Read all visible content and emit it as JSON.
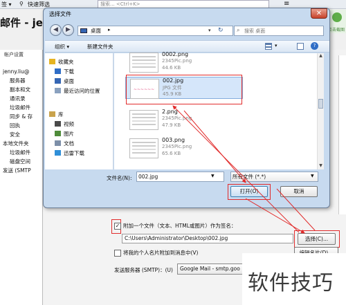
{
  "background": {
    "topbar_left": "签 ▾",
    "quick_filter": "快速筛选",
    "search_placeholder": "搜索... <Ctrl+K>",
    "menu_icon": "≡",
    "heading": "邮件 - jen",
    "right_tool_label": "点击截图",
    "account_panel_title": "帐户设置",
    "account_tree": [
      {
        "label": "jenny.liu@",
        "level": 0
      },
      {
        "label": "服务器",
        "level": 1
      },
      {
        "label": "副本和文",
        "level": 1
      },
      {
        "label": "通讯录",
        "level": 1
      },
      {
        "label": "垃圾邮件",
        "level": 1
      },
      {
        "label": "同步 & 存",
        "level": 1
      },
      {
        "label": "回执",
        "level": 1
      },
      {
        "label": "安全",
        "level": 1
      },
      {
        "label": "本地文件夹",
        "level": 0
      },
      {
        "label": "垃圾邮件",
        "level": 1
      },
      {
        "label": "磁盘空间",
        "level": 1
      },
      {
        "label": "发送 (SMTP",
        "level": 0
      }
    ],
    "signature_checkbox_label": "附加一个文件（文本、HTML或图片）作为签名：",
    "signature_checked": true,
    "signature_path": "C:\\Users\\Administrator\\Desktop\\002.jpg",
    "choose_button": "选择(C)...",
    "vcard_checkbox_label": "将我的个人名片附加到消息中(V)",
    "vcard_checked": false,
    "edit_vcard_button": "编辑名片(D)...",
    "smtp_label": "发送服务器 (SMTP)：(U)",
    "smtp_value": "Google Mail - smtp.goo",
    "watermark": "软件技巧"
  },
  "dialog": {
    "title": "选择文件",
    "close_glyph": "✕",
    "address": {
      "location": "桌面",
      "chevron": "▸"
    },
    "search_placeholder": "搜索 桌面",
    "toolbar": {
      "organize": "组织 ▾",
      "new_folder": "新建文件夹",
      "help": "?"
    },
    "nav_items": [
      {
        "label": "收藏夹",
        "icon": "star-icon"
      },
      {
        "label": "下载",
        "icon": "download-icon"
      },
      {
        "label": "桌面",
        "icon": "desktop-icon"
      },
      {
        "label": "最近访问的位置",
        "icon": "recent-icon"
      },
      {
        "label": "库",
        "icon": "library-icon"
      },
      {
        "label": "视频",
        "icon": "video-icon"
      },
      {
        "label": "图片",
        "icon": "picture-icon"
      },
      {
        "label": "文档",
        "icon": "document-icon"
      },
      {
        "label": "迅雷下载",
        "icon": "thunder-icon"
      }
    ],
    "files": [
      {
        "name": "0002.png",
        "type": "2345Pic.png",
        "size": "44.6 KB",
        "selected": false
      },
      {
        "name": "002.jpg",
        "type": "JPG 文件",
        "size": "45.9 KB",
        "selected": true
      },
      {
        "name": "2.png",
        "type": "2345Pic.png",
        "size": "47.9 KB",
        "selected": false
      },
      {
        "name": "003.png",
        "type": "2345Pic.png",
        "size": "65.6 KB",
        "selected": false
      }
    ],
    "filename_label": "文件名(N):",
    "filename_value": "002.jpg",
    "filetype_value": "所有文件 (*.*)",
    "open_button": "打开(O)",
    "cancel_button": "取消"
  },
  "colors": {
    "annotation_red": "#e12b2b",
    "dialog_frame": "#c7daef",
    "selection": "#d5e6fa"
  }
}
